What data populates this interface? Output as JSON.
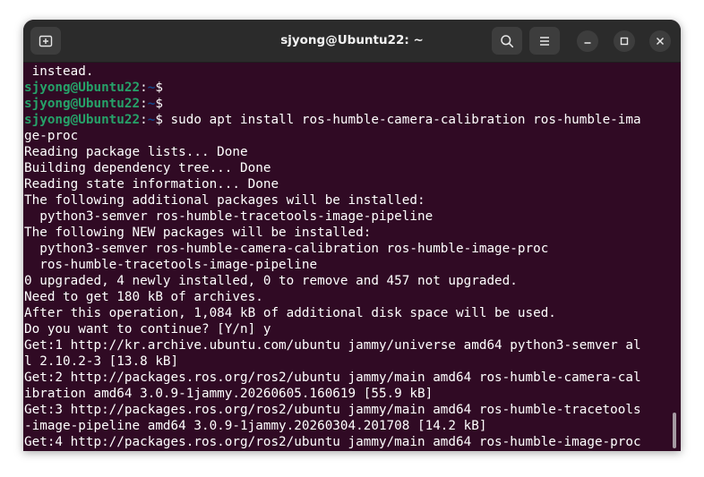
{
  "window": {
    "title": "sjyong@Ubuntu22: ~"
  },
  "icons": {
    "new_tab": "new-tab-icon",
    "search": "search-icon",
    "menu": "hamburger-menu-icon",
    "minimize": "minimize-icon",
    "maximize": "maximize-icon",
    "close": "close-icon"
  },
  "colors": {
    "terminal_bg": "#300a24",
    "titlebar_bg": "#2b2b2b",
    "prompt_user": "#26a269",
    "prompt_path": "#12488b",
    "text": "#ffffff"
  },
  "prompt": {
    "user": "sjyong@Ubuntu22",
    "colon": ":",
    "path": "~",
    "symbol": "$"
  },
  "terminal": {
    "lines": [
      {
        "type": "out",
        "text": " instead."
      },
      {
        "type": "prompt",
        "cmd": ""
      },
      {
        "type": "prompt",
        "cmd": ""
      },
      {
        "type": "prompt",
        "cmd": " sudo apt install ros-humble-camera-calibration ros-humble-ima"
      },
      {
        "type": "out",
        "text": "ge-proc"
      },
      {
        "type": "out",
        "text": "Reading package lists... Done"
      },
      {
        "type": "out",
        "text": "Building dependency tree... Done"
      },
      {
        "type": "out",
        "text": "Reading state information... Done"
      },
      {
        "type": "out",
        "text": "The following additional packages will be installed:"
      },
      {
        "type": "out",
        "text": "  python3-semver ros-humble-tracetools-image-pipeline"
      },
      {
        "type": "out",
        "text": "The following NEW packages will be installed:"
      },
      {
        "type": "out",
        "text": "  python3-semver ros-humble-camera-calibration ros-humble-image-proc"
      },
      {
        "type": "out",
        "text": "  ros-humble-tracetools-image-pipeline"
      },
      {
        "type": "out",
        "text": "0 upgraded, 4 newly installed, 0 to remove and 457 not upgraded."
      },
      {
        "type": "out",
        "text": "Need to get 180 kB of archives."
      },
      {
        "type": "out",
        "text": "After this operation, 1,084 kB of additional disk space will be used."
      },
      {
        "type": "out",
        "text": "Do you want to continue? [Y/n] y"
      },
      {
        "type": "out",
        "text": "Get:1 http://kr.archive.ubuntu.com/ubuntu jammy/universe amd64 python3-semver al"
      },
      {
        "type": "out",
        "text": "l 2.10.2-3 [13.8 kB]"
      },
      {
        "type": "out",
        "text": "Get:2 http://packages.ros.org/ros2/ubuntu jammy/main amd64 ros-humble-camera-cal"
      },
      {
        "type": "out",
        "text": "ibration amd64 3.0.9-1jammy.20260605.160619 [55.9 kB]"
      },
      {
        "type": "out",
        "text": "Get:3 http://packages.ros.org/ros2/ubuntu jammy/main amd64 ros-humble-tracetools"
      },
      {
        "type": "out",
        "text": "-image-pipeline amd64 3.0.9-1jammy.20260304.201708 [14.2 kB]"
      },
      {
        "type": "out",
        "text": "Get:4 http://packages.ros.org/ros2/ubuntu jammy/main amd64 ros-humble-image-proc"
      }
    ]
  }
}
